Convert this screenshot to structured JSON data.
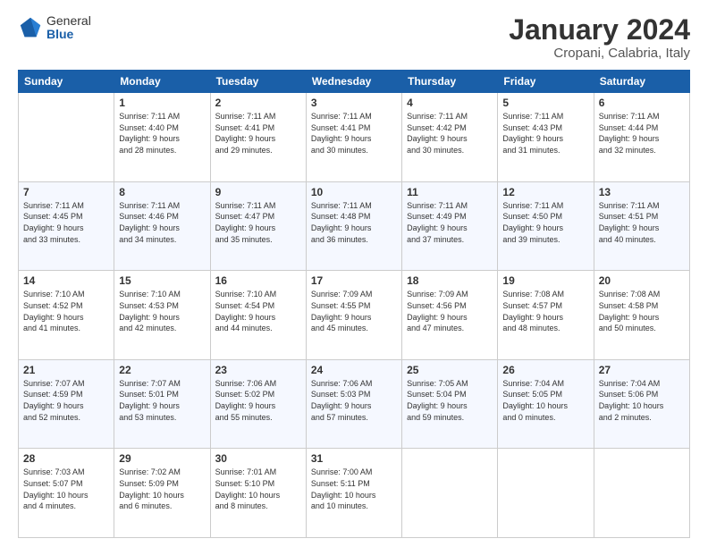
{
  "header": {
    "logo": {
      "general": "General",
      "blue": "Blue"
    },
    "title": "January 2024",
    "location": "Cropani, Calabria, Italy"
  },
  "weekdays": [
    "Sunday",
    "Monday",
    "Tuesday",
    "Wednesday",
    "Thursday",
    "Friday",
    "Saturday"
  ],
  "weeks": [
    [
      {
        "day": "",
        "info": ""
      },
      {
        "day": "1",
        "info": "Sunrise: 7:11 AM\nSunset: 4:40 PM\nDaylight: 9 hours\nand 28 minutes."
      },
      {
        "day": "2",
        "info": "Sunrise: 7:11 AM\nSunset: 4:41 PM\nDaylight: 9 hours\nand 29 minutes."
      },
      {
        "day": "3",
        "info": "Sunrise: 7:11 AM\nSunset: 4:41 PM\nDaylight: 9 hours\nand 30 minutes."
      },
      {
        "day": "4",
        "info": "Sunrise: 7:11 AM\nSunset: 4:42 PM\nDaylight: 9 hours\nand 30 minutes."
      },
      {
        "day": "5",
        "info": "Sunrise: 7:11 AM\nSunset: 4:43 PM\nDaylight: 9 hours\nand 31 minutes."
      },
      {
        "day": "6",
        "info": "Sunrise: 7:11 AM\nSunset: 4:44 PM\nDaylight: 9 hours\nand 32 minutes."
      }
    ],
    [
      {
        "day": "7",
        "info": "Sunrise: 7:11 AM\nSunset: 4:45 PM\nDaylight: 9 hours\nand 33 minutes."
      },
      {
        "day": "8",
        "info": "Sunrise: 7:11 AM\nSunset: 4:46 PM\nDaylight: 9 hours\nand 34 minutes."
      },
      {
        "day": "9",
        "info": "Sunrise: 7:11 AM\nSunset: 4:47 PM\nDaylight: 9 hours\nand 35 minutes."
      },
      {
        "day": "10",
        "info": "Sunrise: 7:11 AM\nSunset: 4:48 PM\nDaylight: 9 hours\nand 36 minutes."
      },
      {
        "day": "11",
        "info": "Sunrise: 7:11 AM\nSunset: 4:49 PM\nDaylight: 9 hours\nand 37 minutes."
      },
      {
        "day": "12",
        "info": "Sunrise: 7:11 AM\nSunset: 4:50 PM\nDaylight: 9 hours\nand 39 minutes."
      },
      {
        "day": "13",
        "info": "Sunrise: 7:11 AM\nSunset: 4:51 PM\nDaylight: 9 hours\nand 40 minutes."
      }
    ],
    [
      {
        "day": "14",
        "info": "Sunrise: 7:10 AM\nSunset: 4:52 PM\nDaylight: 9 hours\nand 41 minutes."
      },
      {
        "day": "15",
        "info": "Sunrise: 7:10 AM\nSunset: 4:53 PM\nDaylight: 9 hours\nand 42 minutes."
      },
      {
        "day": "16",
        "info": "Sunrise: 7:10 AM\nSunset: 4:54 PM\nDaylight: 9 hours\nand 44 minutes."
      },
      {
        "day": "17",
        "info": "Sunrise: 7:09 AM\nSunset: 4:55 PM\nDaylight: 9 hours\nand 45 minutes."
      },
      {
        "day": "18",
        "info": "Sunrise: 7:09 AM\nSunset: 4:56 PM\nDaylight: 9 hours\nand 47 minutes."
      },
      {
        "day": "19",
        "info": "Sunrise: 7:08 AM\nSunset: 4:57 PM\nDaylight: 9 hours\nand 48 minutes."
      },
      {
        "day": "20",
        "info": "Sunrise: 7:08 AM\nSunset: 4:58 PM\nDaylight: 9 hours\nand 50 minutes."
      }
    ],
    [
      {
        "day": "21",
        "info": "Sunrise: 7:07 AM\nSunset: 4:59 PM\nDaylight: 9 hours\nand 52 minutes."
      },
      {
        "day": "22",
        "info": "Sunrise: 7:07 AM\nSunset: 5:01 PM\nDaylight: 9 hours\nand 53 minutes."
      },
      {
        "day": "23",
        "info": "Sunrise: 7:06 AM\nSunset: 5:02 PM\nDaylight: 9 hours\nand 55 minutes."
      },
      {
        "day": "24",
        "info": "Sunrise: 7:06 AM\nSunset: 5:03 PM\nDaylight: 9 hours\nand 57 minutes."
      },
      {
        "day": "25",
        "info": "Sunrise: 7:05 AM\nSunset: 5:04 PM\nDaylight: 9 hours\nand 59 minutes."
      },
      {
        "day": "26",
        "info": "Sunrise: 7:04 AM\nSunset: 5:05 PM\nDaylight: 10 hours\nand 0 minutes."
      },
      {
        "day": "27",
        "info": "Sunrise: 7:04 AM\nSunset: 5:06 PM\nDaylight: 10 hours\nand 2 minutes."
      }
    ],
    [
      {
        "day": "28",
        "info": "Sunrise: 7:03 AM\nSunset: 5:07 PM\nDaylight: 10 hours\nand 4 minutes."
      },
      {
        "day": "29",
        "info": "Sunrise: 7:02 AM\nSunset: 5:09 PM\nDaylight: 10 hours\nand 6 minutes."
      },
      {
        "day": "30",
        "info": "Sunrise: 7:01 AM\nSunset: 5:10 PM\nDaylight: 10 hours\nand 8 minutes."
      },
      {
        "day": "31",
        "info": "Sunrise: 7:00 AM\nSunset: 5:11 PM\nDaylight: 10 hours\nand 10 minutes."
      },
      {
        "day": "",
        "info": ""
      },
      {
        "day": "",
        "info": ""
      },
      {
        "day": "",
        "info": ""
      }
    ]
  ]
}
